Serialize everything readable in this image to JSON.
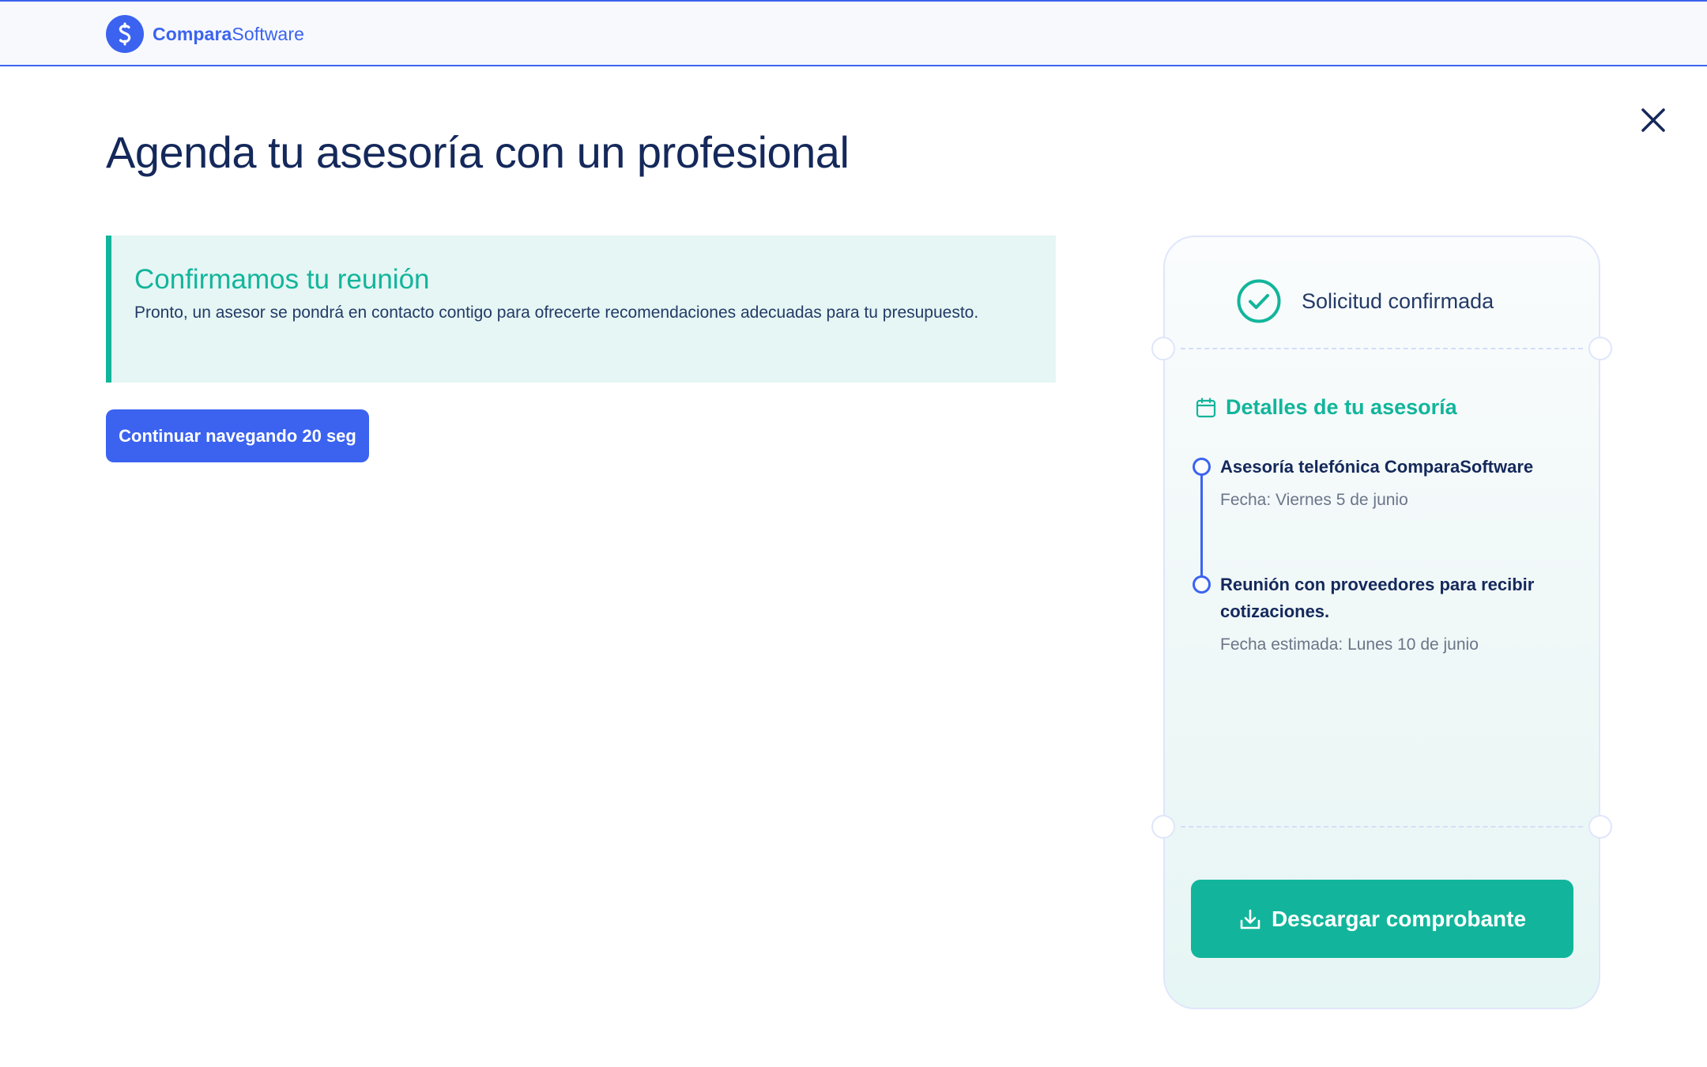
{
  "header": {
    "logo": {
      "brand_bold": "Compara",
      "brand_light": "Software",
      "icon": "logo-s-icon"
    }
  },
  "page": {
    "title": "Agenda tu asesoría con un profesional",
    "close_icon": "close-icon"
  },
  "notice": {
    "title": "Confirmamos tu reunión",
    "text": "Pronto, un asesor se pondrá en contacto contigo para ofrecerte recomendaciones adecuadas para tu presupuesto."
  },
  "continue_button": {
    "label": "Continuar navegando 20 seg"
  },
  "ticket": {
    "status": "Solicitud confirmada",
    "details_title": "Detalles de tu asesoría",
    "steps": [
      {
        "title": "Asesoría telefónica ComparaSoftware",
        "date": "Fecha: Viernes 5 de junio"
      },
      {
        "title": "Reunión con proveedores para recibir cotizaciones.",
        "date": "Fecha estimada: Lunes 10 de junio"
      }
    ],
    "download_label": "Descargar comprobante"
  },
  "colors": {
    "primary": "#3b63f0",
    "accent": "#12b59b",
    "title": "#14285a",
    "notice_bg": "#e5f6f4"
  }
}
